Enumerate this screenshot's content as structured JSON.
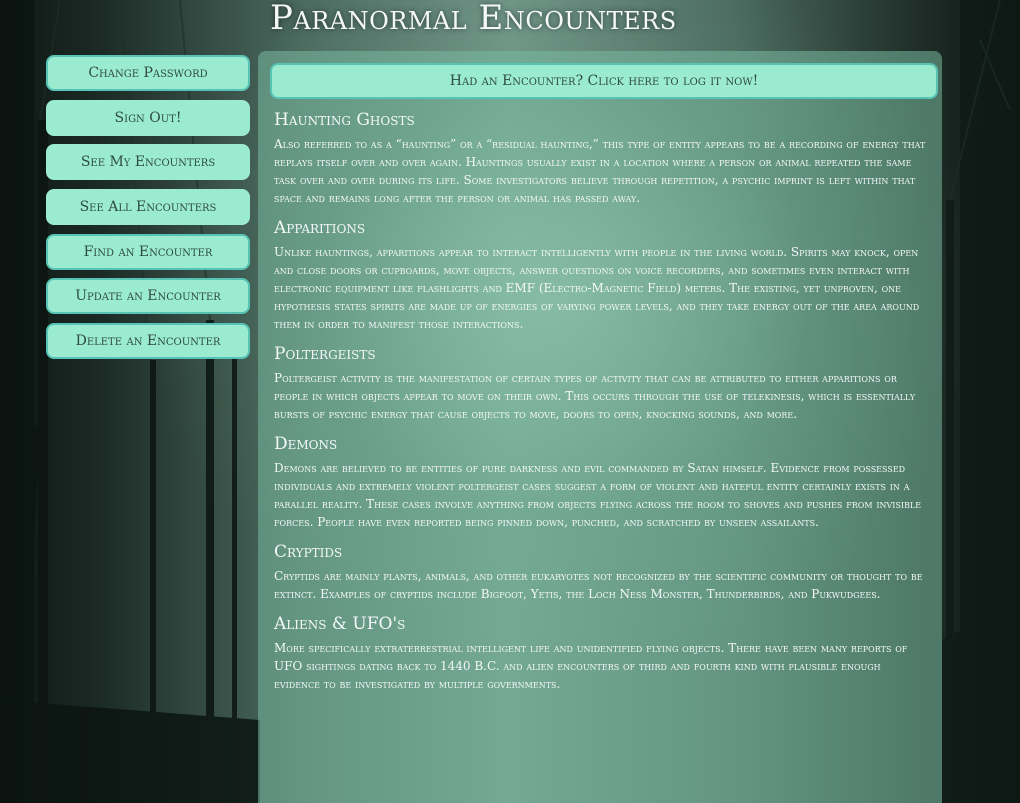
{
  "site": {
    "title": "Paranormal Encounters"
  },
  "sidebar": {
    "items": [
      {
        "label": "Change Password"
      },
      {
        "label": "Sign Out!"
      },
      {
        "label": "See My Encounters"
      },
      {
        "label": "See All Encounters"
      },
      {
        "label": "Find an Encounter"
      },
      {
        "label": "Update an Encounter"
      },
      {
        "label": "Delete an Encounter"
      }
    ]
  },
  "main": {
    "log_button": "Had an Encounter? Click here to log it now!",
    "sections": [
      {
        "title": "Haunting Ghosts",
        "body": "Also referred to as a “haunting” or a “residual haunting,” this type of entity appears to be a recording of energy that replays itself over and over again. Hauntings usually exist in a location where a person or animal repeated the same task over and over during its life. Some investigators believe through repetition, a psychic imprint is left within that space and remains long after the person or animal has passed away."
      },
      {
        "title": "Apparitions",
        "body": "Unlike hauntings, apparitions appear to interact intelligently with people in the living world. Spirits may knock, open and close doors or cupboards, move objects, answer questions on voice recorders, and sometimes even interact with electronic equipment like flashlights and EMF (Electro-Magnetic Field) meters. The existing, yet unproven, one hypothesis states spirits are made up of energies of varying power levels, and they take energy out of the area around them in order to manifest those interactions."
      },
      {
        "title": "Poltergeists",
        "body": "Poltergeist activity is the manifestation of certain types of activity that can be attributed to either apparitions or people in which objects appear to move on their own. This occurs through the use of telekinesis, which is essentially bursts of psychic energy that cause objects to move, doors to open, knocking sounds, and more."
      },
      {
        "title": "Demons",
        "body": "Demons are believed to be entities of pure darkness and evil commanded by Satan himself. Evidence from possessed individuals and extremely violent poltergeist cases suggest a form of violent and hateful entity certainly exists in a parallel reality. These cases involve anything from objects flying across the room to shoves and pushes from invisible forces. People have even reported being pinned down, punched, and scratched by unseen assailants."
      },
      {
        "title": "Cryptids",
        "body": "Cryptids are mainly plants, animals, and other eukaryotes not recognized by the scientific community or thought to be extinct. Examples of cryptids include Bigfoot, Yetis, the Loch Ness Monster, Thunderbirds, and Pukwudgees."
      },
      {
        "title": "Aliens & UFO's",
        "body": "More specifically extraterrestrial intelligent life and unidentified flying objects. There have been many reports of UFO sightings dating back to 1440 B.C. and alien encounters of third and fourth kind with plausible enough evidence to be investigated by multiple governments."
      }
    ]
  }
}
